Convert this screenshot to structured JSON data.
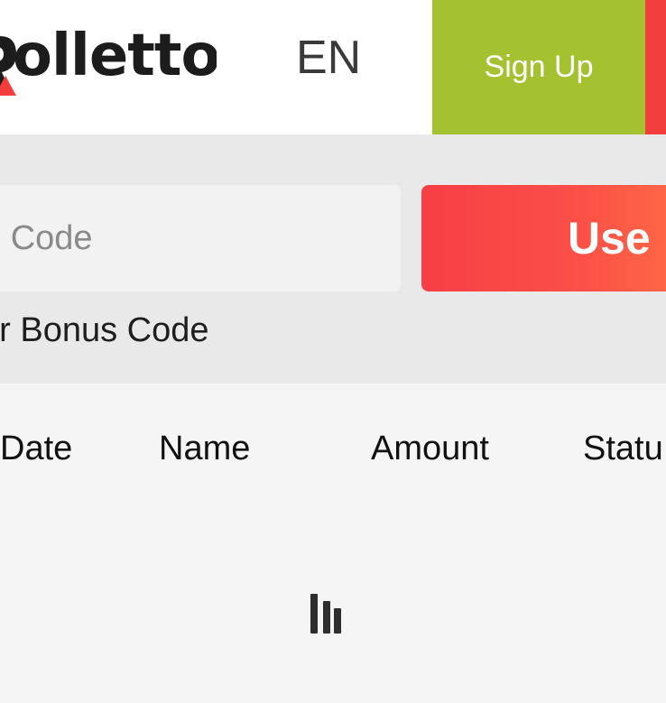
{
  "header": {
    "logo_text": "olletto",
    "language": "EN",
    "signup_label": "Sign Up"
  },
  "promo": {
    "input_placeholder": "o Code",
    "use_label": "Use",
    "caption": "ur Bonus Code"
  },
  "table": {
    "columns": [
      "Date",
      "Name",
      "Amount",
      "Statu"
    ]
  },
  "colors": {
    "signup": "#a4c130",
    "use_button": "#f94546",
    "brand_red": "#f33e3e"
  }
}
